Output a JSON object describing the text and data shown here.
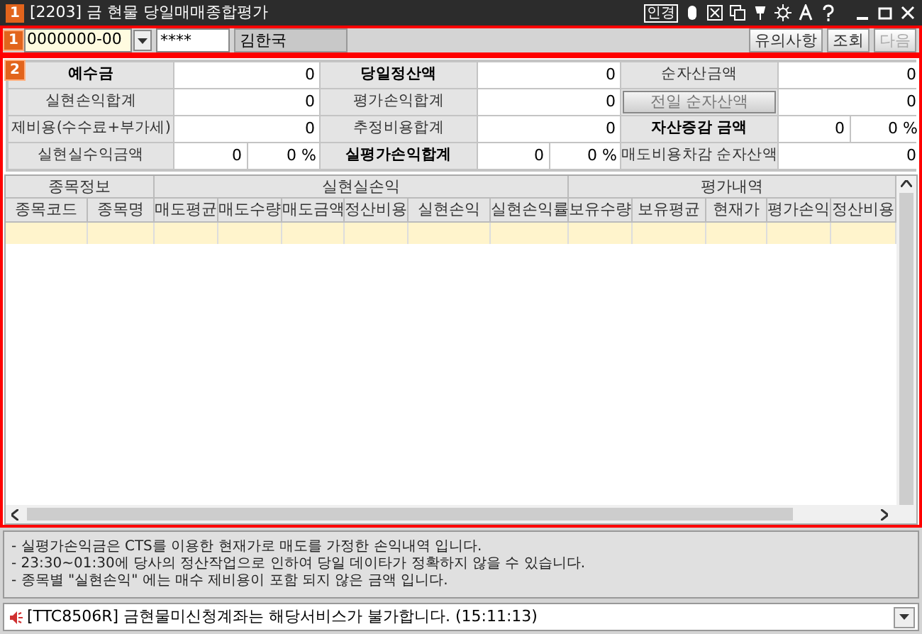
{
  "window": {
    "badge": "1",
    "title": "[2203] 금 현물 당일매매종합평가",
    "tool_text": "인경"
  },
  "toolbar": {
    "badge": "1",
    "account": "0000000-00",
    "password": "****",
    "name": "김한국",
    "buttons": [
      {
        "label": "유의사항",
        "disabled": false
      },
      {
        "label": "조회",
        "disabled": false
      },
      {
        "label": "다음",
        "disabled": true
      }
    ]
  },
  "summary": {
    "badge": "2",
    "rows": [
      [
        {
          "kind": "label",
          "text": "예수금",
          "bold": true
        },
        {
          "kind": "value",
          "text": "0"
        },
        {
          "kind": "label",
          "text": "당일정산액",
          "bold": true
        },
        {
          "kind": "value",
          "text": "0"
        },
        {
          "kind": "label",
          "text": "순자산금액",
          "bold": false
        },
        {
          "kind": "value",
          "text": "0"
        }
      ],
      [
        {
          "kind": "label",
          "text": "실현손익합계",
          "bold": false
        },
        {
          "kind": "value",
          "text": "0"
        },
        {
          "kind": "label",
          "text": "평가손익합계",
          "bold": false
        },
        {
          "kind": "value",
          "text": "0"
        },
        {
          "kind": "button",
          "text": "전일 순자산액",
          "bold": false
        },
        {
          "kind": "value",
          "text": "0"
        }
      ],
      [
        {
          "kind": "label",
          "text": "제비용(수수료+부가세)",
          "bold": false
        },
        {
          "kind": "value",
          "text": "0"
        },
        {
          "kind": "label",
          "text": "추정비용합계",
          "bold": false
        },
        {
          "kind": "value",
          "text": "0"
        },
        {
          "kind": "label",
          "text": "자산증감 금액",
          "bold": true
        },
        {
          "kind": "value",
          "text": "0",
          "percent": "0 %"
        }
      ],
      [
        {
          "kind": "label",
          "text": "실현실수익금액",
          "bold": false
        },
        {
          "kind": "value",
          "text": "0",
          "percent": "0 %"
        },
        {
          "kind": "label",
          "text": "실평가손익합계",
          "bold": true
        },
        {
          "kind": "value",
          "text": "0",
          "percent": "0 %"
        },
        {
          "kind": "label",
          "text": "매도비용차감 순자산액",
          "bold": false
        },
        {
          "kind": "value",
          "text": "0"
        }
      ]
    ]
  },
  "table": {
    "groups": [
      {
        "label": "종목정보",
        "columns": [
          "종목코드",
          "종목명"
        ]
      },
      {
        "label": "실현실손익",
        "columns": [
          "매도평균",
          "매도수량",
          "매도금액",
          "정산비용",
          "실현손익",
          "실현손익률"
        ]
      },
      {
        "label": "평가내역",
        "columns": [
          "보유수량",
          "보유평균",
          "현재가",
          "평가손익",
          "정산비용"
        ]
      }
    ]
  },
  "notes": [
    "- 실평가손익금은 CTS를 이용한 현재가로 매도를 가정한 손익내역 입니다.",
    "- 23:30~01:30에 당사의 정산작업으로 인하여 당일 데이타가 정확하지 않을 수 있습니다.",
    "- 종목별 \"실현손익\" 에는 매수 제비용이 포함 되지 않은 금액 입니다."
  ],
  "status_bar": {
    "message": "[TTC8506R] 금현물미신청계좌는 해당서비스가 불가합니다. (15:11:13)"
  }
}
